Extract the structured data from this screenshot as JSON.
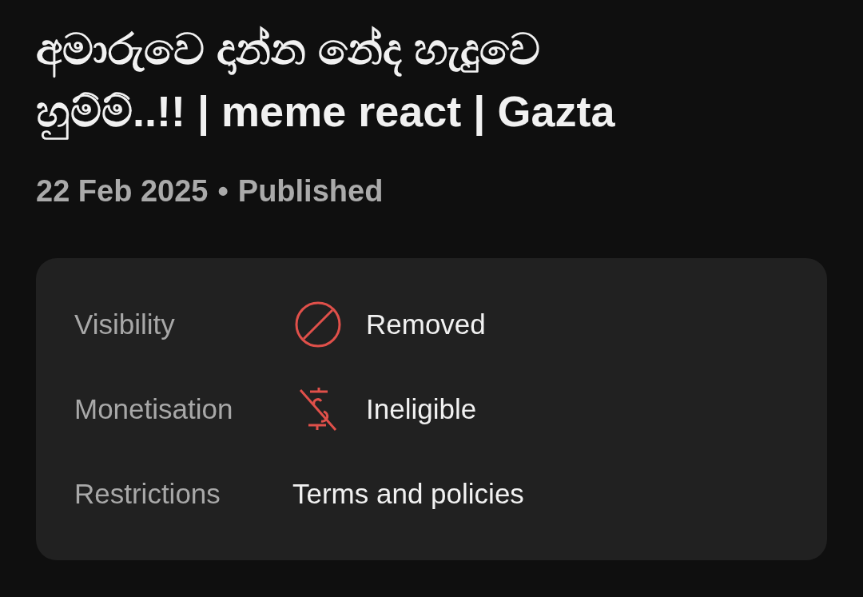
{
  "title": "අමාරුවෙ දාන්න නේද හැදුවෙ හුම්ම්..!! | meme react | Gazta",
  "meta": {
    "date": "22 Feb 2025",
    "separator": "•",
    "status": "Published"
  },
  "details": [
    {
      "label": "Visibility",
      "kind": "removed",
      "value": "Removed"
    },
    {
      "label": "Monetisation",
      "kind": "ineligible",
      "value": "Ineligible"
    },
    {
      "label": "Restrictions",
      "kind": "plain",
      "value": "Terms and policies"
    }
  ]
}
